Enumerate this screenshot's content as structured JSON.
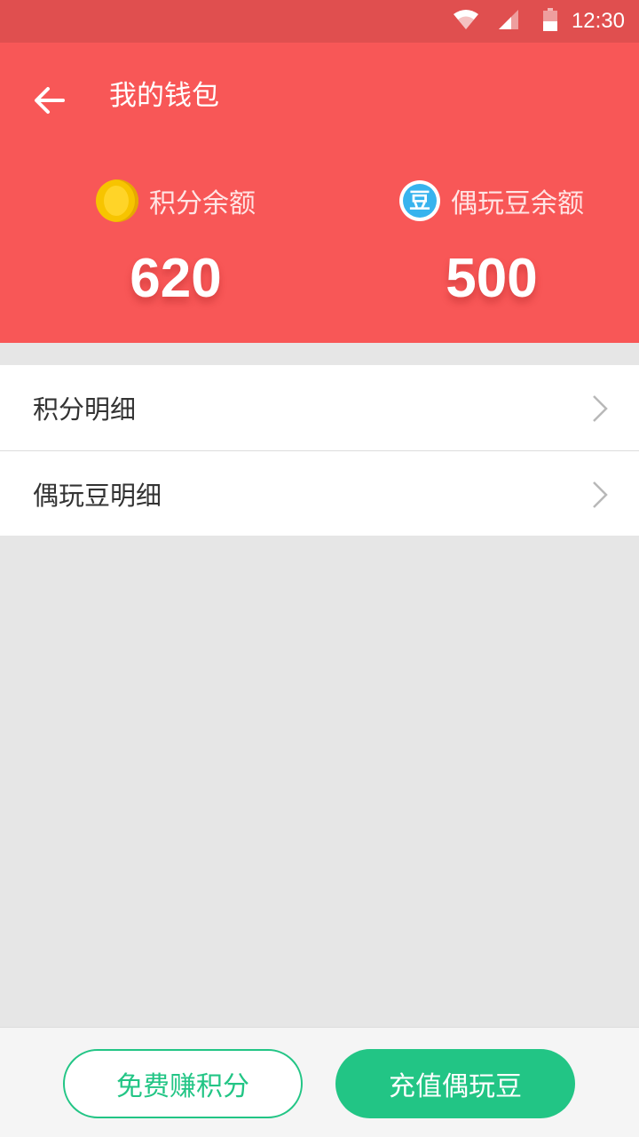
{
  "status_bar": {
    "time": "12:30",
    "icons": [
      "wifi-icon",
      "cellular-signal-icon",
      "battery-icon"
    ]
  },
  "header": {
    "title": "我的钱包",
    "back_icon": "back-arrow-icon",
    "color": "#f85757"
  },
  "balances": {
    "points": {
      "label": "积分余额",
      "value": "620",
      "icon": "coin-icon"
    },
    "beans": {
      "label": "偶玩豆余额",
      "value": "500",
      "icon": "bean-icon",
      "icon_text": "豆"
    }
  },
  "list": {
    "items": [
      {
        "label": "积分明细"
      },
      {
        "label": "偶玩豆明细"
      }
    ]
  },
  "bottom": {
    "earn_label": "免费赚积分",
    "recharge_label": "充值偶玩豆",
    "accent": "#22c585"
  }
}
